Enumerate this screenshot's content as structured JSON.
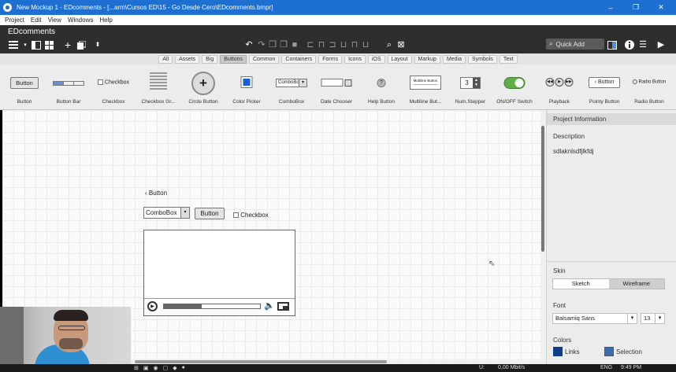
{
  "window": {
    "title": "New Mockup 1 - EDcomments - [...arm\\Cursos ED\\15 - Go Desde Cero\\EDcomments.bmpr]",
    "controls": [
      "–",
      "❐",
      "✕"
    ]
  },
  "menu": [
    "Project",
    "Edit",
    "View",
    "Windows",
    "Help"
  ],
  "app": {
    "name": "EDcomments",
    "quick_add_label": "Quick Add"
  },
  "categories": {
    "items": [
      "All",
      "Assets",
      "Big",
      "Buttons",
      "Common",
      "Containers",
      "Forms",
      "Icons",
      "iOS",
      "Layout",
      "Markup",
      "Media",
      "Symbols",
      "Text"
    ],
    "active": "Buttons"
  },
  "library": {
    "items": [
      {
        "label": "Button",
        "preview": "Button"
      },
      {
        "label": "Button Bar",
        "preview": ""
      },
      {
        "label": "Checkbox",
        "preview": "Checkbox"
      },
      {
        "label": "Checkbox Gr...",
        "preview": ""
      },
      {
        "label": "Circle Button",
        "preview": ""
      },
      {
        "label": "Color Picker",
        "preview": ""
      },
      {
        "label": "ComboBox",
        "preview": "ComboBox"
      },
      {
        "label": "Date Chooser",
        "preview": ""
      },
      {
        "label": "Help Button",
        "preview": ""
      },
      {
        "label": "Multiline But...",
        "preview": "Multiline Button"
      },
      {
        "label": "Num.Stepper",
        "preview": "3"
      },
      {
        "label": "ON/OFF Switch",
        "preview": ""
      },
      {
        "label": "Playback",
        "preview": ""
      },
      {
        "label": "Pointy Button",
        "preview": "Button"
      },
      {
        "label": "Radio Button",
        "preview": "Radio Button"
      }
    ]
  },
  "mockup": {
    "pointy_button": "Button",
    "combobox": "ComboBox",
    "button": "Button",
    "checkbox": "Checkbox"
  },
  "panel": {
    "title": "Project Information",
    "description_label": "Description",
    "description_value": "sdlaknlsdfjlkfdj",
    "skin_label": "Skin",
    "skin_options": [
      "Sketch",
      "Wireframe"
    ],
    "skin_selected": "Wireframe",
    "font_label": "Font",
    "font_value": "Balsamiq Sans",
    "font_size": "13",
    "colors_label": "Colors",
    "links_label": "Links",
    "selection_label": "Selection",
    "links_color": "#0f3e8c",
    "selection_color": "#3a6db0"
  },
  "taskbar": {
    "net": "0,00 Mbit/s",
    "lang": "ENG",
    "time": "9:49 PM"
  }
}
